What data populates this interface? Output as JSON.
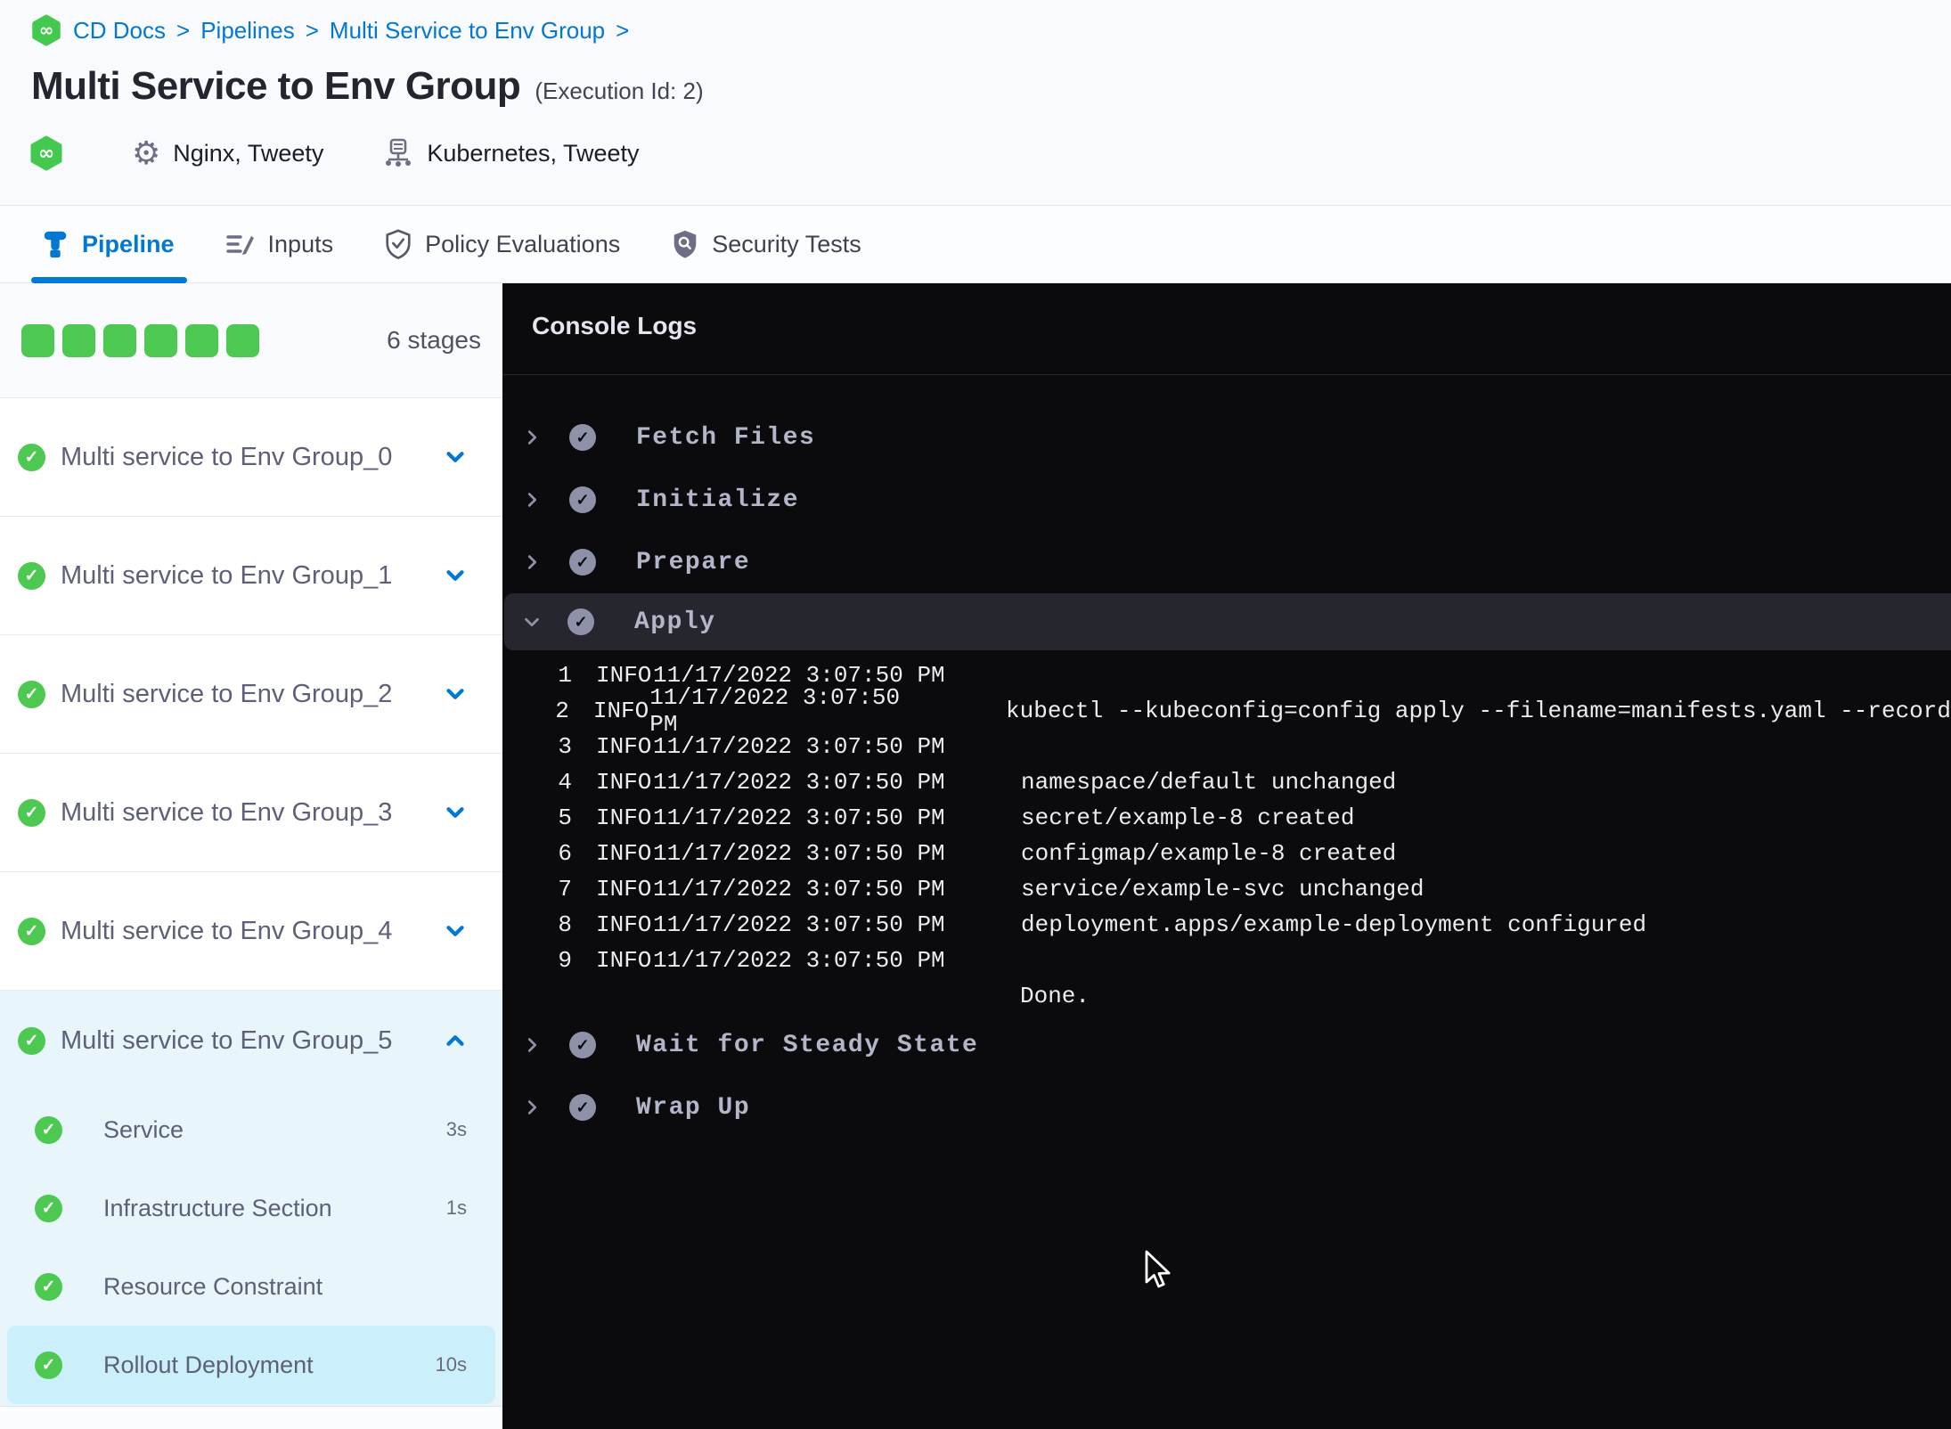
{
  "colors": {
    "accent_blue": "#0278d5",
    "success_green": "#4dc952",
    "console_bg": "#0b0b0e",
    "selected_step_bg": "#cbeffb",
    "expanded_stage_bg": "#e8f5fb"
  },
  "breadcrumb": {
    "items": [
      "CD Docs",
      "Pipelines",
      "Multi Service to Env Group"
    ],
    "separator": ">"
  },
  "header": {
    "title": "Multi Service to Env Group",
    "execution_id_label": "(Execution Id: 2)",
    "service_label": "Nginx, Tweety",
    "infrastructure_label": "Kubernetes, Tweety"
  },
  "tabs": {
    "items": [
      {
        "label": "Pipeline",
        "icon": "pipeline-icon",
        "active": true
      },
      {
        "label": "Inputs",
        "icon": "inputs-icon",
        "active": false
      },
      {
        "label": "Policy Evaluations",
        "icon": "shield-check-icon",
        "active": false
      },
      {
        "label": "Security Tests",
        "icon": "shield-search-icon",
        "active": false
      }
    ]
  },
  "stages_panel": {
    "stage_count_label": "6 stages",
    "square_count": 6,
    "collapsed_stages": [
      {
        "label": "Multi service to Env Group_0"
      },
      {
        "label": "Multi service to Env Group_1"
      },
      {
        "label": "Multi service to Env Group_2"
      },
      {
        "label": "Multi service to Env Group_3"
      },
      {
        "label": "Multi service to Env Group_4"
      }
    ],
    "expanded_stage": {
      "label": "Multi service to Env Group_5",
      "steps": [
        {
          "label": "Service",
          "duration": "3s",
          "selected": false
        },
        {
          "label": "Infrastructure Section",
          "duration": "1s",
          "selected": false
        },
        {
          "label": "Resource Constraint",
          "duration": "",
          "selected": false
        },
        {
          "label": "Rollout Deployment",
          "duration": "10s",
          "selected": true
        }
      ]
    }
  },
  "console": {
    "title": "Console Logs",
    "sections_before": [
      "Fetch Files",
      "Initialize",
      "Prepare"
    ],
    "expanded_section": {
      "label": "Apply",
      "logs": [
        {
          "line": "1",
          "level": "INFO",
          "timestamp": "11/17/2022 3:07:50 PM",
          "message": ""
        },
        {
          "line": "2",
          "level": "INFO",
          "timestamp": "11/17/2022 3:07:50 PM",
          "message": "kubectl --kubeconfig=config apply --filename=manifests.yaml --record"
        },
        {
          "line": "3",
          "level": "INFO",
          "timestamp": "11/17/2022 3:07:50 PM",
          "message": ""
        },
        {
          "line": "4",
          "level": "INFO",
          "timestamp": "11/17/2022 3:07:50 PM",
          "message": "namespace/default unchanged"
        },
        {
          "line": "5",
          "level": "INFO",
          "timestamp": "11/17/2022 3:07:50 PM",
          "message": "secret/example-8 created"
        },
        {
          "line": "6",
          "level": "INFO",
          "timestamp": "11/17/2022 3:07:50 PM",
          "message": "configmap/example-8 created"
        },
        {
          "line": "7",
          "level": "INFO",
          "timestamp": "11/17/2022 3:07:50 PM",
          "message": "service/example-svc unchanged"
        },
        {
          "line": "8",
          "level": "INFO",
          "timestamp": "11/17/2022 3:07:50 PM",
          "message": "deployment.apps/example-deployment configured"
        },
        {
          "line": "9",
          "level": "INFO",
          "timestamp": "11/17/2022 3:07:50 PM",
          "message": ""
        }
      ],
      "footer_message": "Done."
    },
    "sections_after": [
      "Wait for Steady State",
      "Wrap Up"
    ]
  }
}
